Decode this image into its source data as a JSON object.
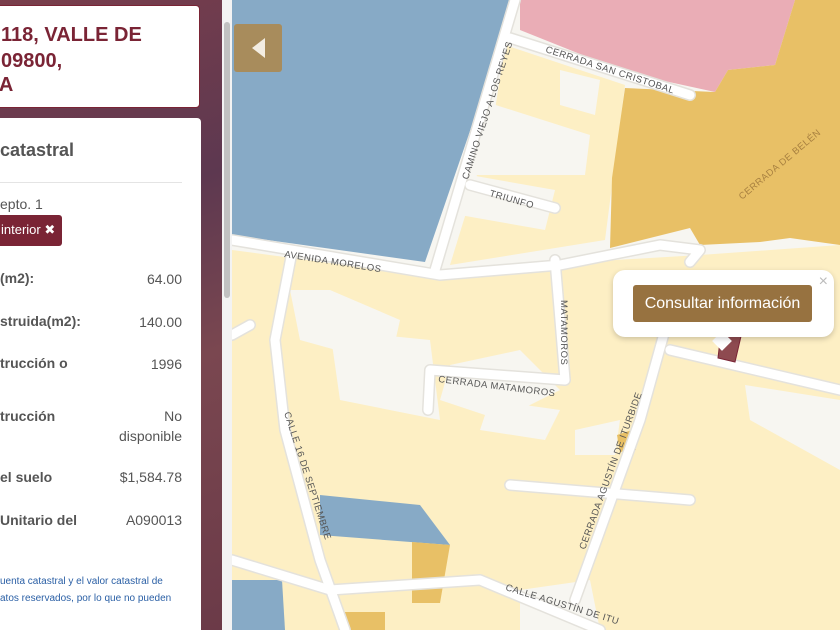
{
  "address": {
    "line1": "118, VALLE DE",
    "line2": "09800,",
    "line3": "PA"
  },
  "info": {
    "title": "catastral",
    "subtitle": "epto. 1",
    "chip_label": "interior ✖",
    "rows": [
      {
        "label": "(m2):",
        "value": "64.00"
      },
      {
        "label": "struida(m2):",
        "value": "140.00"
      },
      {
        "label": "trucción o",
        "value": "1996"
      },
      {
        "label": "trucción",
        "value": "No disponible"
      },
      {
        "label": "el suelo",
        "value": "$1,584.78"
      },
      {
        "label": "Unitario del",
        "value": "A090013"
      }
    ],
    "note_line1": "uenta catastral y el valor catastral de",
    "note_line2": "atos reservados, por lo que no pueden"
  },
  "map": {
    "popup_button": "Consultar información",
    "popup_close": "×",
    "streets": {
      "avenida_morelos": "AVENIDA MORELOS",
      "camino_viejo": "CAMINO VIEJO A LOS REYES",
      "san_cristobal": "CERRADA SAN CRISTOBAL",
      "triunfo": "TRIUNFO",
      "belen": "CERRADA DE BELÉN",
      "matamoros": "MATAMOROS",
      "cerrada_matamoros": "CERRADA MATAMOROS",
      "calle_16": "CALLE 16 DE SEPTIEMBRE",
      "cerrada_iturbide": "CERRADA AGUSTÍN DE ITURBIDE",
      "calle_iturbide": "CALLE AGUSTÍN DE ITU"
    },
    "colors": {
      "blue": "#87aac6",
      "pink": "#eaadb6",
      "gold": "#e8c066",
      "lot": "#fdefc4",
      "selected": "#8e4a50"
    }
  }
}
